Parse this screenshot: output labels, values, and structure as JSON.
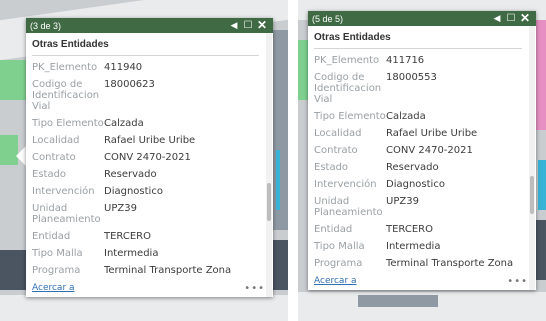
{
  "left_popup": {
    "counter": "(3 de 3)",
    "prev_icon": "◀",
    "maximize_icon": "☐",
    "close_icon": "✕",
    "title": "Otras Entidades",
    "rows": [
      {
        "key": "PK_Elemento",
        "value": "411940"
      },
      {
        "key": "Codigo de Identificacion Vial",
        "value": "18000623"
      },
      {
        "key": "Tipo Elemento",
        "value": "Calzada"
      },
      {
        "key": "Localidad",
        "value": "Rafael Uribe Uribe"
      },
      {
        "key": "Contrato",
        "value": "CONV 2470-2021"
      },
      {
        "key": "Estado",
        "value": "Reservado"
      },
      {
        "key": "Intervención",
        "value": "Diagnostico"
      },
      {
        "key": "Unidad Planeamiento",
        "value": "UPZ39"
      },
      {
        "key": "Entidad",
        "value": "TERCERO"
      },
      {
        "key": "Tipo Malla",
        "value": "Intermedia"
      },
      {
        "key": "Programa",
        "value": "Terminal Transporte Zona"
      }
    ],
    "zoom_link": "Acercar a",
    "more": "•••"
  },
  "right_popup": {
    "counter": "(5 de 5)",
    "prev_icon": "◀",
    "maximize_icon": "☐",
    "close_icon": "✕",
    "title": "Otras Entidades",
    "rows": [
      {
        "key": "PK_Elemento",
        "value": "411716"
      },
      {
        "key": "Codigo de Identificacion Vial",
        "value": "18000553"
      },
      {
        "key": "Tipo Elemento",
        "value": "Calzada"
      },
      {
        "key": "Localidad",
        "value": "Rafael Uribe Uribe"
      },
      {
        "key": "Contrato",
        "value": "CONV 2470-2021"
      },
      {
        "key": "Estado",
        "value": "Reservado"
      },
      {
        "key": "Intervención",
        "value": "Diagnostico"
      },
      {
        "key": "Unidad Planeamiento",
        "value": "UPZ39"
      },
      {
        "key": "Entidad",
        "value": "TERCERO"
      },
      {
        "key": "Tipo Malla",
        "value": "Intermedia"
      },
      {
        "key": "Programa",
        "value": "Terminal Transporte Zona"
      }
    ],
    "zoom_link": "Acercar a",
    "more": "•••"
  },
  "colors": {
    "header_bg": "#3f6a43",
    "link": "#2f6fb5",
    "label": "#9aa0a4",
    "value": "#3c3c3c"
  }
}
